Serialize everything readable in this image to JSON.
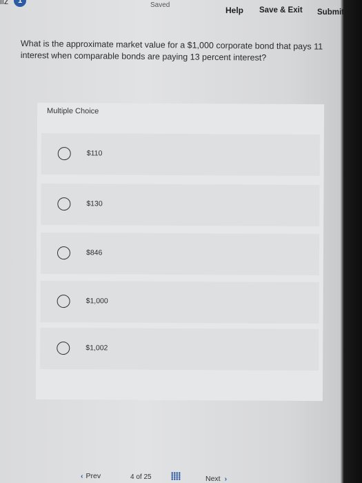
{
  "header": {
    "quiz_tag": "iiz",
    "info_badge": "1",
    "saved": "Saved",
    "help": "Help",
    "save_exit": "Save & Exit",
    "submit": "Submit"
  },
  "question": {
    "text": "What is the approximate market value for a $1,000 corporate bond that pays 11 interest when comparable bonds are paying 13 percent interest?"
  },
  "multiple_choice": {
    "title": "Multiple Choice",
    "choices": [
      {
        "label": "$110"
      },
      {
        "label": "$130"
      },
      {
        "label": "$846"
      },
      {
        "label": "$1,000"
      },
      {
        "label": "$1,002"
      }
    ]
  },
  "footer": {
    "prev": "Prev",
    "page_current": "4",
    "page_of": "of",
    "page_total": "25",
    "next": "Next"
  },
  "colors": {
    "accent": "#2d5ba3"
  }
}
